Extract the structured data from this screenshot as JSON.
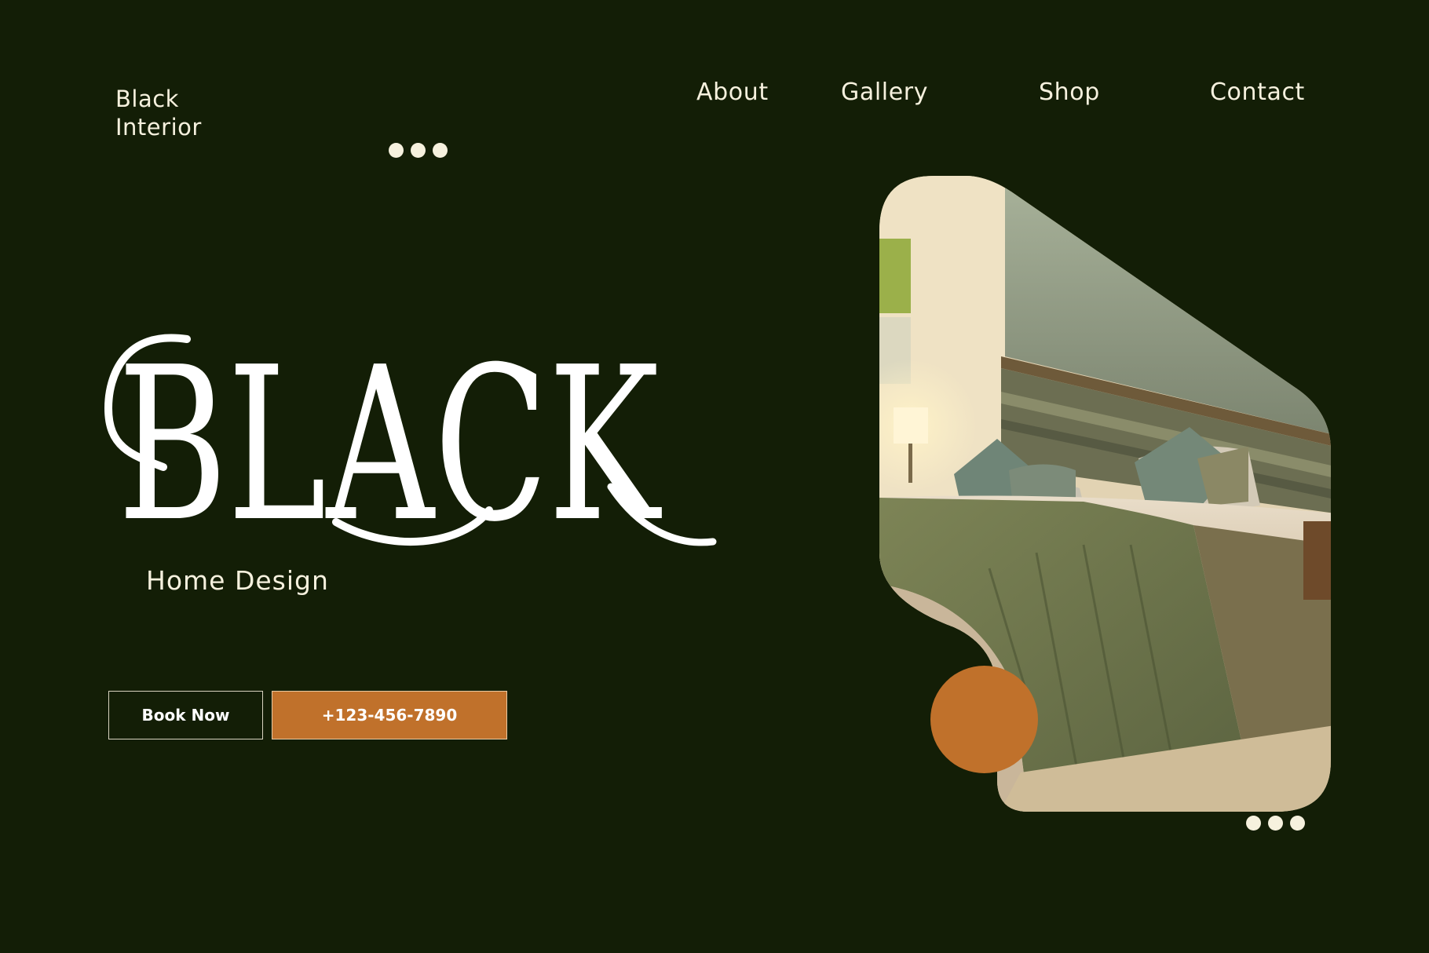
{
  "brand": {
    "line1": "Black",
    "line2": "Interior"
  },
  "nav": {
    "items": [
      "About",
      "Gallery",
      "Shop",
      "Contact"
    ]
  },
  "hero": {
    "title": "BLACK",
    "subtitle": "Home Design"
  },
  "buttons": {
    "book": "Book Now",
    "phone": "+123-456-7890"
  },
  "colors": {
    "background": "#131e06",
    "text": "#f6f1de",
    "accent": "#c0712b"
  },
  "image": {
    "subject": "bedroom-interior-photo"
  }
}
